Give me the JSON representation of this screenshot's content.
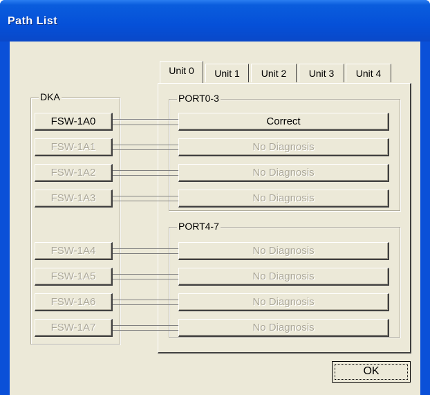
{
  "window": {
    "title": "Path List"
  },
  "tabs": [
    "Unit 0",
    "Unit 1",
    "Unit 2",
    "Unit 3",
    "Unit 4"
  ],
  "dka": {
    "label": "DKA",
    "buttons": [
      "FSW-1A0",
      "FSW-1A1",
      "FSW-1A2",
      "FSW-1A3",
      "FSW-1A4",
      "FSW-1A5",
      "FSW-1A6",
      "FSW-1A7"
    ],
    "enabled": [
      true,
      false,
      false,
      false,
      false,
      false,
      false,
      false
    ]
  },
  "port_groups": [
    {
      "label": "PORT0-3",
      "statuses": [
        "Correct",
        "No Diagnosis",
        "No Diagnosis",
        "No Diagnosis"
      ]
    },
    {
      "label": "PORT4-7",
      "statuses": [
        "No Diagnosis",
        "No Diagnosis",
        "No Diagnosis",
        "No Diagnosis"
      ]
    }
  ],
  "ok_button": {
    "label": "OK"
  }
}
